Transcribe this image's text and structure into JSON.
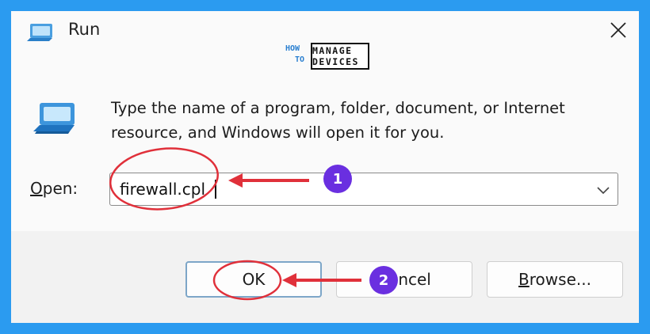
{
  "window": {
    "title": "Run",
    "close_icon": "close-icon",
    "app_icon": "run-app-icon"
  },
  "watermark": {
    "how": "HOW",
    "to": "TO",
    "manage": "MANAGE",
    "devices": "DEVICES"
  },
  "dialog": {
    "description": "Type the name of a program, folder, document, or Internet resource, and Windows will open it for you.",
    "open_label_accel": "O",
    "open_label_rest": "pen:",
    "open_value": "firewall.cpl",
    "dropdown_icon": "chevron-down-icon"
  },
  "buttons": {
    "ok": "OK",
    "cancel": "Cancel",
    "browse_accel": "B",
    "browse_rest": "rowse..."
  },
  "annotations": {
    "step1": "1",
    "step2": "2",
    "highlight_color": "#e0303a",
    "badge_color": "#6a2fe0"
  },
  "colors": {
    "frame": "#2b9bf0",
    "window_bg": "#fafafa",
    "footer_bg": "#f2f2f2"
  }
}
